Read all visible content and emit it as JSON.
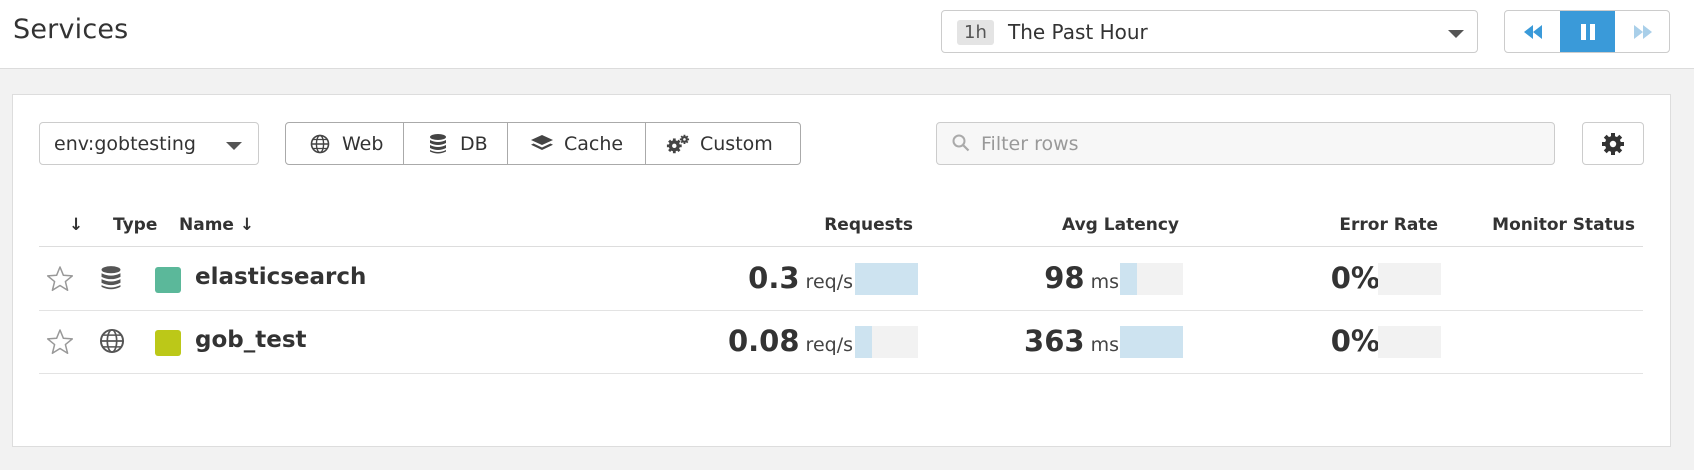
{
  "header": {
    "title": "Services",
    "time_range": {
      "badge": "1h",
      "label": "The Past Hour"
    },
    "playback": {
      "rewind_icon": "rewind-icon",
      "pause_icon": "pause-icon",
      "forward_icon": "fast-forward-icon",
      "active_color": "#3a9ad9"
    }
  },
  "toolbar": {
    "env_filter": "env:gobtesting",
    "type_filters": [
      {
        "label": "Web",
        "icon": "globe-icon"
      },
      {
        "label": "DB",
        "icon": "database-icon"
      },
      {
        "label": "Cache",
        "icon": "layers-icon"
      },
      {
        "label": "Custom",
        "icon": "gears-icon"
      }
    ],
    "filter_placeholder": "Filter rows",
    "settings_icon": "gear-icon"
  },
  "table": {
    "columns": {
      "sort": "↓",
      "type": "Type",
      "name": "Name ↓",
      "requests": "Requests",
      "latency": "Avg Latency",
      "error_rate": "Error Rate",
      "monitor_status": "Monitor Status"
    },
    "rows": [
      {
        "type_icon": "database-icon",
        "color": "#5bb89a",
        "name": "elasticsearch",
        "requests": {
          "value": "0.3",
          "unit": "req/s",
          "fraction": 1.0
        },
        "latency": {
          "value": "98",
          "unit": "ms",
          "fraction": 0.27
        },
        "error_rate": {
          "value": "0%",
          "fraction": 0.0
        }
      },
      {
        "type_icon": "globe-icon",
        "color": "#bcc818",
        "name": "gob_test",
        "requests": {
          "value": "0.08",
          "unit": "req/s",
          "fraction": 0.27
        },
        "latency": {
          "value": "363",
          "unit": "ms",
          "fraction": 1.0
        },
        "error_rate": {
          "value": "0%",
          "fraction": 0.0
        }
      }
    ]
  }
}
